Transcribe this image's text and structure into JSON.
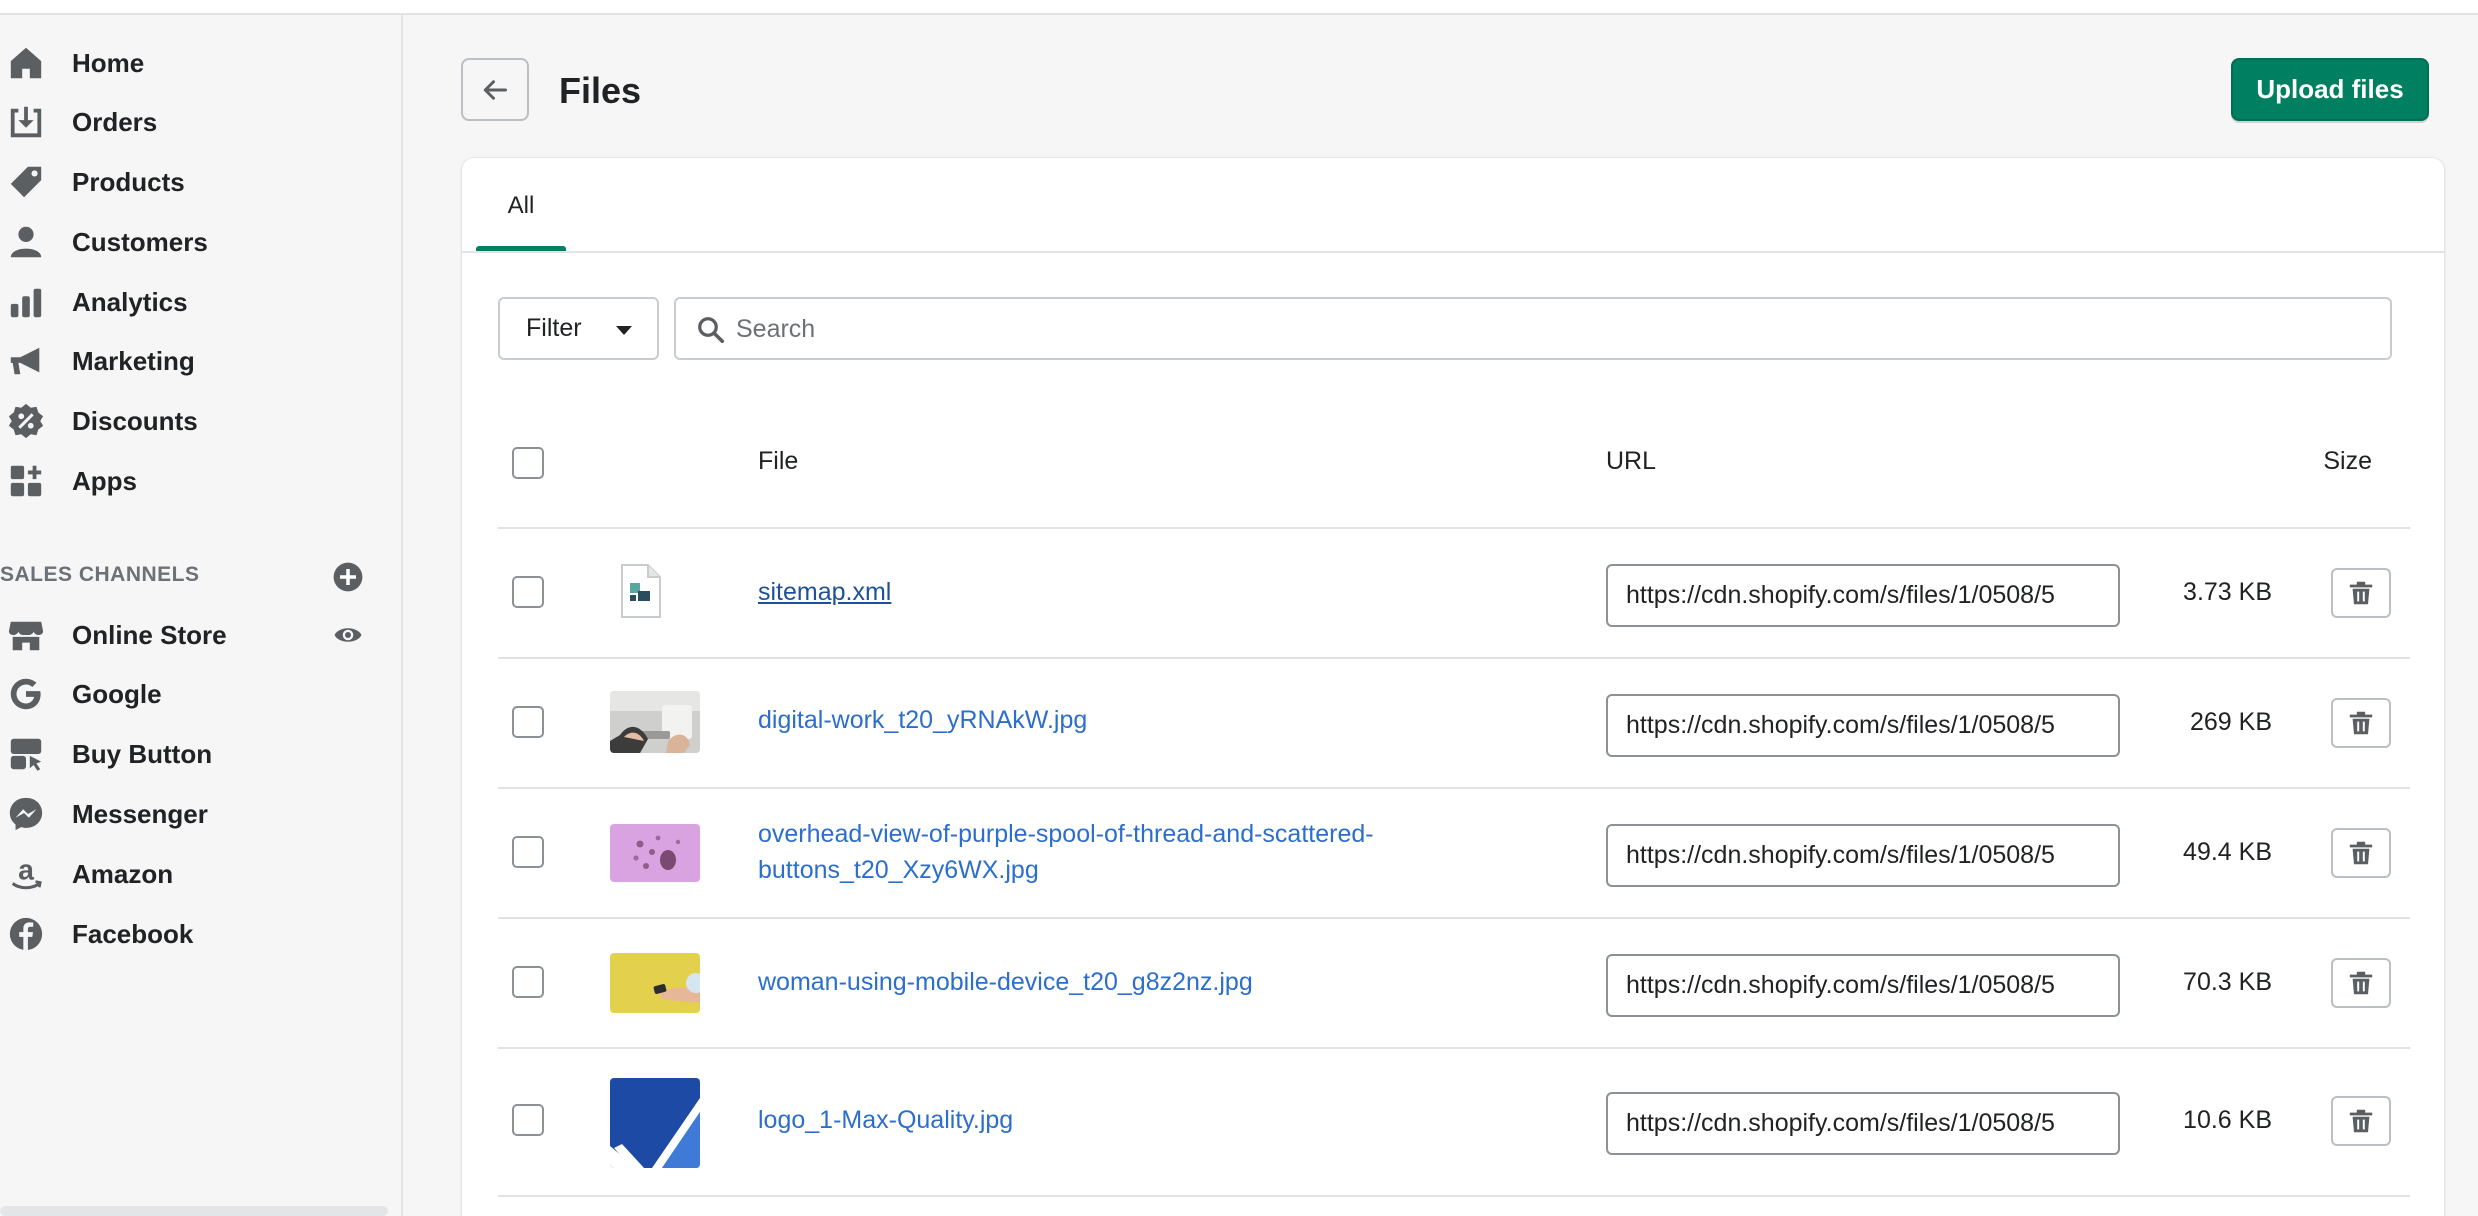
{
  "sidebar": {
    "items": [
      {
        "label": "Home",
        "icon": "home-icon"
      },
      {
        "label": "Orders",
        "icon": "orders-icon"
      },
      {
        "label": "Products",
        "icon": "tag-icon"
      },
      {
        "label": "Customers",
        "icon": "person-icon"
      },
      {
        "label": "Analytics",
        "icon": "bar-chart-icon"
      },
      {
        "label": "Marketing",
        "icon": "megaphone-icon"
      },
      {
        "label": "Discounts",
        "icon": "discount-icon"
      },
      {
        "label": "Apps",
        "icon": "apps-icon"
      }
    ],
    "channels_title": "SALES CHANNELS",
    "channels": [
      {
        "label": "Online Store",
        "icon": "store-icon"
      },
      {
        "label": "Google",
        "icon": "google-icon"
      },
      {
        "label": "Buy Button",
        "icon": "buy-button-icon"
      },
      {
        "label": "Messenger",
        "icon": "messenger-icon"
      },
      {
        "label": "Amazon",
        "icon": "amazon-icon"
      },
      {
        "label": "Facebook",
        "icon": "facebook-icon"
      }
    ]
  },
  "header": {
    "title": "Files",
    "upload_label": "Upload files"
  },
  "tabs": [
    {
      "label": "All"
    }
  ],
  "filter": {
    "label": "Filter"
  },
  "search": {
    "placeholder": "Search"
  },
  "table": {
    "columns": {
      "file": "File",
      "url": "URL",
      "size": "Size"
    },
    "rows": [
      {
        "name": "sitemap.xml",
        "url": "https://cdn.shopify.com/s/files/1/0508/5",
        "size": "3.73 KB"
      },
      {
        "name": "digital-work_t20_yRNAkW.jpg",
        "url": "https://cdn.shopify.com/s/files/1/0508/5",
        "size": "269 KB"
      },
      {
        "name_line1": "overhead-view-of-purple-spool-of-thread-and-scattered-",
        "name_line2": "buttons_t20_Xzy6WX.jpg",
        "url": "https://cdn.shopify.com/s/files/1/0508/5",
        "size": "49.4 KB"
      },
      {
        "name": "woman-using-mobile-device_t20_g8z2nz.jpg",
        "url": "https://cdn.shopify.com/s/files/1/0508/5",
        "size": "70.3 KB"
      },
      {
        "name": "logo_1-Max-Quality.jpg",
        "url": "https://cdn.shopify.com/s/files/1/0508/5",
        "size": "10.6 KB"
      }
    ]
  },
  "colors": {
    "accent": "#008060",
    "link": "#2c6ecb"
  }
}
